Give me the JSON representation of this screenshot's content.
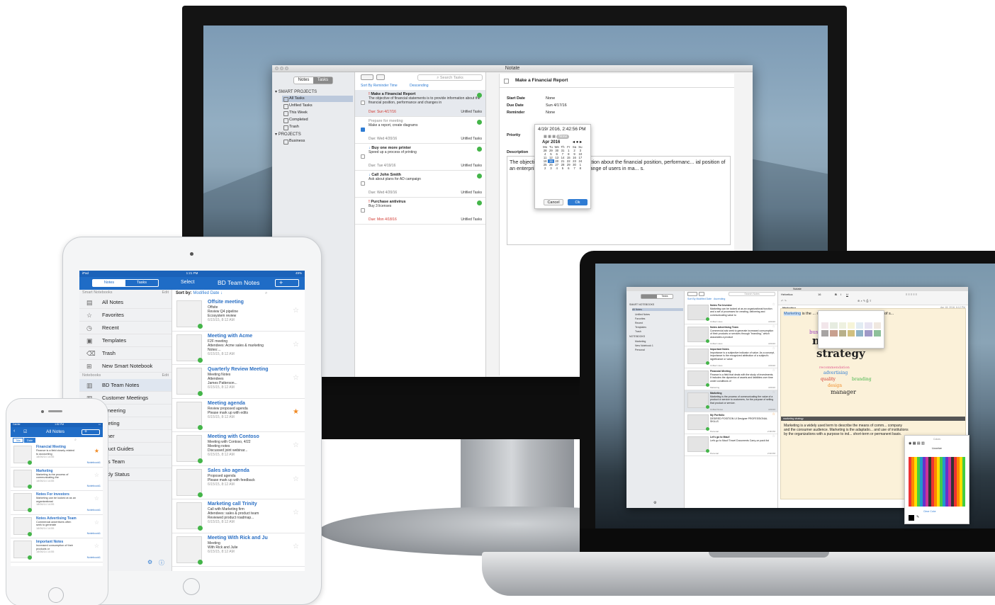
{
  "colors": {
    "accent": "#2f7cd3",
    "navbar": "#1f6cc6",
    "done_green": "#44b549",
    "priority_red": "#d0342c",
    "star_orange": "#f08a24"
  },
  "imac": {
    "window_title": "Notate",
    "toggle": [
      "Notes",
      "Tasks"
    ],
    "sidebar": {
      "smart_projects_header": "SMART PROJECTS",
      "smart_items": [
        "All Tasks",
        "Unfiled Tasks",
        "This Week",
        "Completed",
        "Trash"
      ],
      "projects_header": "PROJECTS",
      "project_items": [
        "Business"
      ]
    },
    "search_placeholder": "Search Tasks",
    "sort": {
      "field": "Sort By Reminder Time",
      "order": "Descending"
    },
    "tasks": [
      {
        "title": "Make a Financial Report",
        "desc": "The objective of financial statements is to provide information about the financial position, performance and changes in",
        "due": "Due: Sun 4/17/16",
        "list": "Unfiled Tasks"
      },
      {
        "title": "Prepare for meeting",
        "desc": "Make a report, create diagrams",
        "due": "Due: Wed 4/20/16",
        "list": "Unfiled Tasks"
      },
      {
        "title": "Buy one more printer",
        "desc": "Speed up a process of printing",
        "due": "Due: Tue 4/19/16",
        "list": "Unfiled Tasks"
      },
      {
        "title": "Call John Smith",
        "desc": "Ask about plans for AD campaign",
        "due": "Due: Wed 4/20/16",
        "list": "Unfiled Tasks"
      },
      {
        "title": "Purchase antivirus",
        "desc": "Buy 3 licenses",
        "due": "Due: Mon 4/18/16",
        "list": "Unfiled Tasks"
      }
    ],
    "detail": {
      "title": "Make a Financial Report",
      "start_label": "Start Date",
      "start_value": "None",
      "due_label": "Due Date",
      "due_value": "Sun 4/17/16",
      "reminder_label": "Reminder",
      "reminder_value": "None",
      "priority_label": "Priority",
      "description_label": "Description",
      "description_text": "The objecti... ts is to provide information about the financial position, performanc... ial position of an enterprise that is useful to wide range of users in ma... s.",
      "picker_datetime": "4/19/ 2016,  2:42:56 PM",
      "picker_month": "Apr 2016",
      "picker_none": "None",
      "picker_days": [
        "Mo",
        "Tu",
        "We",
        "Th",
        "Fr",
        "Sa",
        "Su",
        "28",
        "29",
        "30",
        "31",
        "1",
        "2",
        "3",
        "4",
        "5",
        "6",
        "7",
        "8",
        "9",
        "10",
        "11",
        "12",
        "13",
        "14",
        "15",
        "16",
        "17",
        "18",
        "19",
        "20",
        "21",
        "22",
        "23",
        "24",
        "25",
        "26",
        "27",
        "28",
        "29",
        "30",
        "1",
        "2",
        "3",
        "4",
        "5",
        "6",
        "7",
        "8"
      ],
      "picker_selected": "19",
      "cancel_label": "Cancel",
      "ok_label": "Ok"
    }
  },
  "macbook": {
    "window_title": "Notate",
    "toggle": "Tasks",
    "search_placeholder": "Search Notes",
    "font_name": "Helvetica",
    "font_size": "16",
    "sort": {
      "field": "Sort By Modified Date",
      "order": "Ascending"
    },
    "sidebar": {
      "smart_header": "SMART NOTEBOOKS",
      "smart_items": [
        "All Notes",
        "Unfiled Notes",
        "Favorites",
        "Recent",
        "Templates",
        "Trash"
      ],
      "notebooks_header": "NOTEBOOKS",
      "notebook_items": [
        "Marketing",
        "New Notebook 1",
        "Personal"
      ]
    },
    "notes": [
      {
        "title": "Notes For Investor",
        "body": "Marketing can be looked at as an organizational function and a set of processes for creating, delivering and communicating value to",
        "tag": "Unfiled notes",
        "date": "4/19/16"
      },
      {
        "title": "Notes Advertising Team",
        "body": "Commercial ads seek to generate increased consumption of their products or services through \"branding,\" which associates a product",
        "tag": "Unfiled notes",
        "date": "4/19/16"
      },
      {
        "title": "Important Notes",
        "body": "Importance is a subjective indicator of value. As a concept, importance is the recognized attribution of a subject's significance or value",
        "tag": "Unfiled notes",
        "date": "4/19/16"
      },
      {
        "title": "Financial Meeting",
        "body": "Finance is a field that deals with the study of investments. It includes the dynamics of assets and liabilities over time under conditions of",
        "tag": "Marketing",
        "date": "4/19/16"
      },
      {
        "title": "Marketing",
        "body": "Marketing is the process of communicating the value of a product or service to customers, for the purpose of selling that product or service.",
        "tag": "Unfiled Notes",
        "date": "4/19/16"
      },
      {
        "title": "My Portfolio",
        "body": "DESIRED POSITION UI Designer PROFESSIONAL SKILLS",
        "tag": "Personal",
        "date": "2:38 PM"
      },
      {
        "title": "Let's go to Maui!",
        "body": "Let's go to Maui! Travel Documents Carry-on pack list",
        "tag": "Personal",
        "date": "2:30 PM"
      }
    ],
    "doc": {
      "title": "Marketing",
      "date": "Apr 18, 2016, 6:12 PM",
      "intro_highlight": "Marketing",
      "intro_rest": " is the ... r service to customers, for the purpose of s...",
      "art_words": [
        "marketing",
        "strategy",
        "products",
        "business",
        "recommendation",
        "advertising",
        "quality",
        "branding",
        "design",
        "manager"
      ],
      "caption": "marketing strategy",
      "body": "Marketing is a widely used term to describe the means of comm... company and the consumer audience. Marketing is the adaptatio... and use of institutions by the organizations with a purpose to ind... short-term or permanent basis.",
      "pencils_title": "Colors",
      "pencils_label": "Licorice",
      "clear_color": "Clear Color"
    }
  },
  "ipad": {
    "status_left": "iPad",
    "status_time": "1:21 PM",
    "status_right": "49%",
    "toggle": [
      "Notes",
      "Tasks"
    ],
    "select_label": "Select",
    "title": "BD Team Notes",
    "smart_header": "Smart Notebooks",
    "edit_label": "Edit",
    "smart_items": [
      {
        "label": "All Notes",
        "icon": "notes-icon"
      },
      {
        "label": "Favorites",
        "icon": "star-icon"
      },
      {
        "label": "Recent",
        "icon": "clock-icon"
      },
      {
        "label": "Templates",
        "icon": "template-icon"
      },
      {
        "label": "Trash",
        "icon": "trash-icon"
      },
      {
        "label": "New Smart Notebook",
        "icon": "add-notebook-icon"
      }
    ],
    "notebooks_header": "Notebooks",
    "notebooks": [
      "BD Team Notes",
      "Customer Meetings",
      "ngineering",
      "arketing",
      "artner",
      "roduct Guides",
      "ales Team",
      "eekly Status"
    ],
    "sort_label": "Sort by:",
    "sort_value": "Modified Date",
    "notes": [
      {
        "title": "Offsite meeting",
        "body": "Offsite\nReview Q4 pipeline\nEcosystem review",
        "time": "6/15/15, 8:12 AM",
        "fav": false
      },
      {
        "title": "Meeting with Acme",
        "body": "F2F meeting\nAttendees: Acme sales & marketing\nNotes:...",
        "time": "6/15/15, 8:12 AM",
        "fav": false
      },
      {
        "title": "Quarterly Review Meeting",
        "body": "Meeting Notes\nAttendees\nJames Patterson...",
        "time": "6/15/15, 8:12 AM",
        "fav": false
      },
      {
        "title": "Meeting agenda",
        "body": "Review proposed agenda\nPlease mark up with edits",
        "time": "6/15/15, 8:12 AM",
        "fav": true
      },
      {
        "title": "Meeting with Contoso",
        "body": "Meeting with Contoso, 4/22\nMeeting notes\nDiscussed joint webinar...",
        "time": "6/15/15, 8:12 AM",
        "fav": false
      },
      {
        "title": "Sales sko agenda",
        "body": "Proposed agenda\nPlease mark up with feedback",
        "time": "6/15/15, 8:12 AM",
        "fav": false
      },
      {
        "title": "Marketing call Trinity",
        "body": "Call with Marketing firm\nAttendees: sales & product team\nReviewed product roadmap...",
        "time": "6/15/15, 8:12 AM",
        "fav": false
      },
      {
        "title": "Meeting  With Rick and Ju",
        "body": "Meeting\nWith Rick and Julie",
        "time": "6/15/15, 8:12 AM",
        "fav": false
      }
    ]
  },
  "iphone": {
    "status_left": "Carrier",
    "status_time": "1:52 PM",
    "title": "All Notes",
    "tabs": [
      "Title",
      "Date"
    ],
    "notes": [
      {
        "title": "Financial Meeting",
        "body": "Finance is a field closely related to accounting",
        "time": "18/06/14 14:55",
        "notebook": "Notebook1",
        "fav": true
      },
      {
        "title": "Marketing",
        "body": "Marketing is the process of communicating the",
        "time": "18/06/14 14:55",
        "notebook": "Notebook1",
        "fav": false
      },
      {
        "title": "Notes For investors",
        "body": "Marketing can be looked at as an organizational",
        "time": "18/06/14 14:55",
        "notebook": "Notebook1",
        "fav": false
      },
      {
        "title": "Notes Advertising Team",
        "body": "Commercial advertisers often seek to generate",
        "time": "18/06/14 14:55",
        "notebook": "Notebook1",
        "fav": false
      },
      {
        "title": "Important Notes",
        "body": "Increased consumption of their products or",
        "time": "18/06/14 14:55",
        "notebook": "Notebook1",
        "fav": false
      }
    ]
  }
}
